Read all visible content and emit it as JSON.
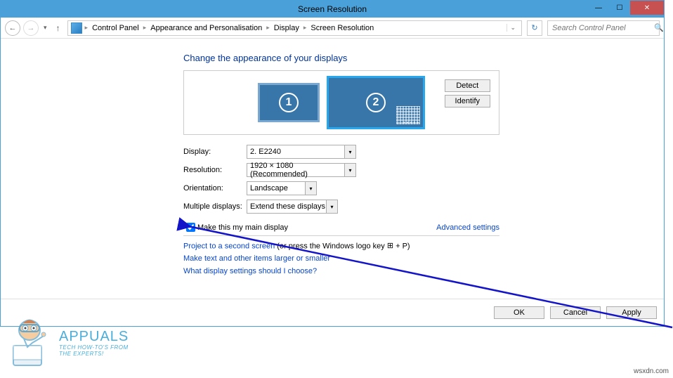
{
  "window": {
    "title": "Screen Resolution"
  },
  "toolbar": {
    "breadcrumb": [
      "Control Panel",
      "Appearance and Personalisation",
      "Display",
      "Screen Resolution"
    ],
    "search_placeholder": "Search Control Panel"
  },
  "content": {
    "heading": "Change the appearance of your displays",
    "monitors": {
      "m1": "1",
      "m2": "2"
    },
    "side_buttons": {
      "detect": "Detect",
      "identify": "Identify"
    },
    "labels": {
      "display": "Display:",
      "resolution": "Resolution:",
      "orientation": "Orientation:",
      "multiple": "Multiple displays:"
    },
    "values": {
      "display": "2. E2240",
      "resolution": "1920 × 1080 (Recommended)",
      "orientation": "Landscape",
      "multiple": "Extend these displays"
    },
    "checkbox_label": "Make this my main display",
    "advanced_link": "Advanced settings",
    "project_link": "Project to a second screen",
    "project_suffix_a": " (or press the Windows logo key ",
    "project_suffix_b": " + P)",
    "text_size_link": "Make text and other items larger or smaller",
    "help_link": "What display settings should I choose?"
  },
  "footer": {
    "ok": "OK",
    "cancel": "Cancel",
    "apply": "Apply"
  },
  "watermark": {
    "name": "APPUALS",
    "tag1": "TECH HOW-TO'S FROM",
    "tag2": "THE EXPERTS!",
    "attrib": "wsxdn.com"
  }
}
